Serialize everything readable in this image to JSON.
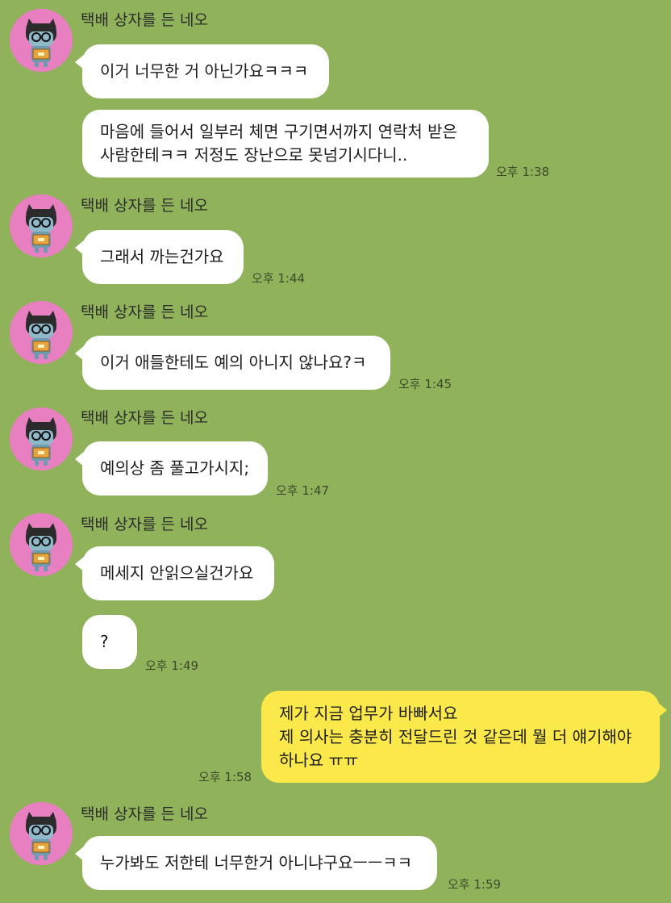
{
  "chat": {
    "sender_name": "택배 상자를 든 네오",
    "messages": [
      {
        "text": "이거 너무한 거 아닌가요ㅋㅋㅋ"
      },
      {
        "text": "마음에 들어서 일부러 체면 구기면서까지 연락처 받은\n사람한테ㅋㅋ 저정도 장난으로 못넘기시다니..",
        "time": "오후 1:38"
      },
      {
        "text": "그래서 까는건가요",
        "time": "오후 1:44"
      },
      {
        "text": "이거 애들한테도 예의 아니지 않나요?ㅋ",
        "time": "오후 1:45"
      },
      {
        "text": "예의상 좀 풀고가시지;",
        "time": "오후 1:47"
      },
      {
        "text": "메세지 안읽으실건가요"
      },
      {
        "text": "?",
        "time": "오후 1:49"
      },
      {
        "text": "제가 지금 업무가 바빠서요\n제 의사는 충분히 전달드린 것 같은데 뭘 더 얘기해야\n하나요 ㅠㅠ",
        "time": "오후 1:58"
      },
      {
        "text": "누가봐도 저한테 너무한거 아니냐구요ㅡㅡㅋㅋ",
        "time": "오후 1:59"
      }
    ]
  },
  "colors": {
    "background": "#8fb25a",
    "incoming_bubble": "#ffffff",
    "outgoing_bubble": "#fbe84a",
    "avatar_bg": "#e87fc0"
  },
  "icons": {
    "avatar": "neo-with-box-avatar-icon"
  }
}
